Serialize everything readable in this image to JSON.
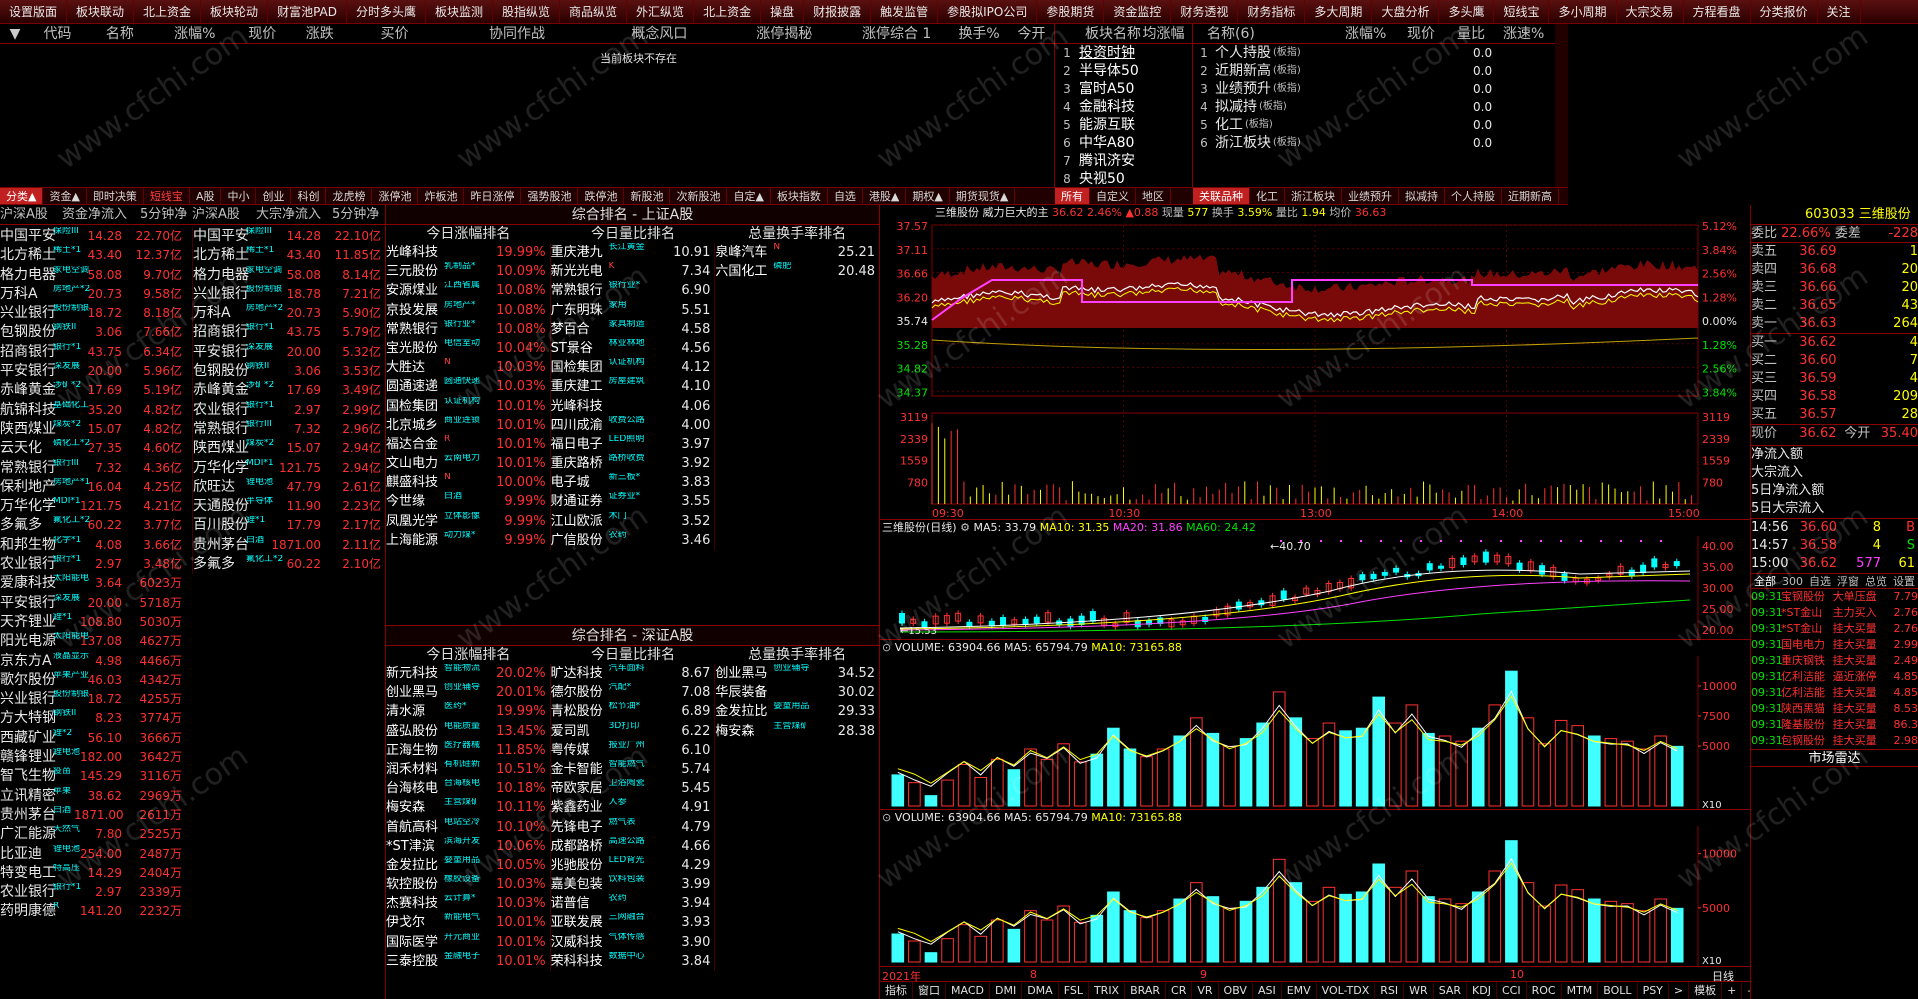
{
  "topbar": [
    "设置版面",
    "板块联动",
    "北上资金",
    "板块轮动",
    "财富池PAD",
    "分时多头鹰",
    "板块监测",
    "股指纵览",
    "商品纵览",
    "外汇纵览",
    "北上资金",
    "操盘",
    "财报披露",
    "触发监管",
    "参股拟IPO公司",
    "参股期货",
    "资金监控",
    "财务透视",
    "财务指标",
    "多大周期",
    "大盘分析",
    "多头鹰",
    "短线宝",
    "多小周期",
    "大宗交易",
    "方程看盘",
    "分类报价",
    "关注"
  ],
  "list_header": {
    "code": "代码",
    "name": "名称",
    "chg": "涨幅%",
    "price": "现价",
    "diff": "涨跌",
    "buy": "买价",
    "c1": "协同作战",
    "c2": "概念风口",
    "c3": "涨停揭秘",
    "c4": "涨停综合 1",
    "c5": "换手%",
    "c6": "今开"
  },
  "empty_text": "当前板块不存在",
  "sector_panel": {
    "h1": "板块名称",
    "h2": "均涨幅",
    "items": [
      "投资时钟",
      "半导体50",
      "富时A50",
      "金融科技",
      "能源互联",
      "中华A80",
      "腾讯济安",
      "央视50"
    ]
  },
  "related_panel": {
    "h_name": "名称(6)",
    "h_chg": "涨幅%",
    "h_price": "现价",
    "h_vol": "量比",
    "h_speed": "涨速%",
    "tag": "(板指)",
    "items": [
      {
        "name": "个人持股",
        "vol": "0.0"
      },
      {
        "name": "近期新高",
        "vol": "0.0"
      },
      {
        "name": "业绩预升",
        "vol": "0.0"
      },
      {
        "name": "拟减持",
        "vol": "0.0"
      },
      {
        "name": "化工",
        "vol": "0.0"
      },
      {
        "name": "浙江板块",
        "vol": "0.0"
      }
    ]
  },
  "tabs_left": [
    "分类▲",
    "资金▲",
    "即时决策",
    "短线宝",
    "A股",
    "中小",
    "创业",
    "科创",
    "龙虎榜",
    "涨停池",
    "炸板池",
    "昨日涨停",
    "强势股池",
    "跌停池",
    "新股池",
    "次新股池",
    "自定▲",
    "板块指数",
    "自选",
    "港股▲",
    "期权▲",
    "期货现货▲"
  ],
  "tabs_right": [
    "所有",
    "自定义",
    "地区"
  ],
  "tabs_rel": [
    "关联品种",
    "化工",
    "浙江板块",
    "业绩预升",
    "拟减持",
    "个人持股",
    "近期新高"
  ],
  "capital": {
    "h1": "沪深A股",
    "h2": "资金净流入",
    "h3": "5分钟净",
    "h4": "沪深A股",
    "h5": "大宗净流入",
    "h6": "5分钟净",
    "left": [
      [
        "中国平安",
        "保险III",
        "14.28",
        "22.70亿"
      ],
      [
        "北方稀土",
        "稀土*1",
        "43.40",
        "12.37亿"
      ],
      [
        "格力电器",
        "家电空调",
        "58.08",
        "9.70亿"
      ],
      [
        "万科A",
        "房地产*2",
        "20.73",
        "9.58亿"
      ],
      [
        "兴业银行",
        "股份制银",
        "18.72",
        "8.18亿"
      ],
      [
        "包钢股份",
        "钢铁II",
        "3.06",
        "7.66亿"
      ],
      [
        "招商银行",
        "银行*1",
        "43.75",
        "6.34亿"
      ],
      [
        "平安银行",
        "深发展",
        "20.00",
        "5.96亿"
      ],
      [
        "赤峰黄金",
        "涉矿*2",
        "17.69",
        "5.19亿"
      ],
      [
        "航锦科技",
        "基础化工",
        "35.20",
        "4.82亿"
      ],
      [
        "陕西煤业",
        "煤炭*2",
        "15.07",
        "4.82亿"
      ],
      [
        "云天化",
        "磷化工*2",
        "27.35",
        "4.60亿"
      ],
      [
        "常熟银行",
        "银行III",
        "7.32",
        "4.36亿"
      ],
      [
        "保利地产",
        "房地产*1",
        "16.04",
        "4.25亿"
      ],
      [
        "万华化学",
        "MDI*1",
        "121.75",
        "4.21亿"
      ],
      [
        "多氟多",
        "氟化工*2",
        "60.22",
        "3.77亿"
      ],
      [
        "和邦生物",
        "化学*1",
        "4.08",
        "3.66亿"
      ],
      [
        "农业银行",
        "银行*1",
        "2.97",
        "3.48亿"
      ],
      [
        "爱康科技",
        "太阳能电",
        "3.64",
        "6023万"
      ],
      [
        "平安银行",
        "深发展",
        "20.00",
        "5718万"
      ],
      [
        "天齐锂业",
        "锂*1",
        "108.80",
        "5030万"
      ],
      [
        "阳光电源",
        "太阳能电",
        "137.08",
        "4627万"
      ],
      [
        "京东方A",
        "液晶显示",
        "4.98",
        "4466万"
      ],
      [
        "歌尔股份",
        "苹果产业",
        "46.03",
        "4342万"
      ],
      [
        "兴业银行",
        "股份制银",
        "18.72",
        "4255万"
      ],
      [
        "方大特钢",
        "钢铁II",
        "8.23",
        "3774万"
      ],
      [
        "西藏矿业",
        "锂*2",
        "56.10",
        "3666万"
      ],
      [
        "赣锋锂业",
        "锂电池",
        "182.00",
        "3642万"
      ],
      [
        "智飞生物",
        "疫苗",
        "145.29",
        "3116万"
      ],
      [
        "立讯精密",
        "苹果",
        "38.62",
        "2969万"
      ],
      [
        "贵州茅台",
        "白酒",
        "1871.00",
        "2611万"
      ],
      [
        "广汇能源",
        "天然气",
        "7.80",
        "2525万"
      ],
      [
        "比亚迪",
        "锂电池",
        "254.00",
        "2487万"
      ],
      [
        "特变电工",
        "特高压",
        "14.29",
        "2404万"
      ],
      [
        "农业银行",
        "银行*1",
        "2.97",
        "2339万"
      ],
      [
        "药明康德",
        "R",
        "141.20",
        "2232万"
      ]
    ],
    "right": [
      [
        "中国平安",
        "保险III",
        "14.28",
        "22.10亿"
      ],
      [
        "北方稀土",
        "稀土*1",
        "43.40",
        "11.85亿"
      ],
      [
        "格力电器",
        "家电空调",
        "58.08",
        "8.14亿"
      ],
      [
        "兴业银行",
        "股份制银",
        "18.78",
        "7.21亿"
      ],
      [
        "万科A",
        "房地产*2",
        "20.73",
        "5.90亿"
      ],
      [
        "招商银行",
        "银行*1",
        "43.75",
        "5.79亿"
      ],
      [
        "平安银行",
        "深发展",
        "20.00",
        "5.32亿"
      ],
      [
        "包钢股份",
        "钢铁II",
        "3.06",
        "3.53亿"
      ],
      [
        "赤峰黄金",
        "涉矿*2",
        "17.69",
        "3.49亿"
      ],
      [
        "农业银行",
        "银行*1",
        "2.97",
        "2.99亿"
      ],
      [
        "常熟银行",
        "银行III",
        "7.32",
        "2.96亿"
      ],
      [
        "陕西煤业",
        "煤炭*2",
        "15.07",
        "2.94亿"
      ],
      [
        "万华化学",
        "MDI*1",
        "121.75",
        "2.94亿"
      ],
      [
        "欣旺达",
        "锂电池",
        "47.79",
        "2.61亿"
      ],
      [
        "天通股份",
        "半导体",
        "11.90",
        "2.23亿"
      ],
      [
        "百川股份",
        "锂*1",
        "17.79",
        "2.17亿"
      ],
      [
        "贵州茅台",
        "白酒",
        "1871.00",
        "2.11亿"
      ],
      [
        "多氟多",
        "氟化工*2",
        "60.22",
        "2.10亿"
      ]
    ]
  },
  "ranks": [
    {
      "title": "综合排名 - 上证A股",
      "c1": "今日涨幅排名",
      "c2": "今日量比排名",
      "c3": "总量换手率排名",
      "a": [
        [
          "光峰科技",
          "",
          "19.99%"
        ],
        [
          "三元股份",
          "乳制品*",
          "10.09%"
        ],
        [
          "安源煤业",
          "江西省属",
          "10.08%"
        ],
        [
          "京投发展",
          "房地产*",
          "10.08%"
        ],
        [
          "常熟银行",
          "银行业*",
          "10.08%"
        ],
        [
          "宝光股份",
          "电信室动",
          "10.04%"
        ],
        [
          "大胜达",
          "N",
          "10.03%"
        ],
        [
          "圆通速递",
          "圆通快递",
          "10.03%"
        ],
        [
          "国检集团",
          "认证机构",
          "10.01%"
        ],
        [
          "北京城乡",
          "商业连锁",
          "10.01%"
        ],
        [
          "福达合金",
          "R",
          "10.01%"
        ],
        [
          "文山电力",
          "云南电力",
          "10.01%"
        ],
        [
          "麒盛科技",
          "N",
          "10.00%"
        ],
        [
          "今世缘",
          "白酒",
          "9.99%"
        ],
        [
          "凤凰光学",
          "立体影像",
          "9.99%"
        ],
        [
          "上海能源",
          "动力煤*",
          "9.99%"
        ]
      ],
      "b": [
        [
          "重庆港九",
          "长江黄金",
          "10.91"
        ],
        [
          "新光光电",
          "K",
          "7.34"
        ],
        [
          "常熟银行",
          "银行业*",
          "6.90"
        ],
        [
          "广东明珠",
          "家用",
          "5.51"
        ],
        [
          "梦百合",
          "家具制造",
          "4.58"
        ],
        [
          "ST景谷",
          "林业林地",
          "4.56"
        ],
        [
          "国检集团",
          "认证机构",
          "4.12"
        ],
        [
          "重庆建工",
          "房屋建筑",
          "4.10"
        ],
        [
          "光峰科技",
          "",
          "4.06"
        ],
        [
          "四川成渝",
          "收费公路",
          "4.00"
        ],
        [
          "福日电子",
          "LED照明",
          "3.97"
        ],
        [
          "重庆路桥",
          "路桥收费",
          "3.92"
        ],
        [
          "电子城",
          "新三板*",
          "3.83"
        ],
        [
          "财通证券",
          "证券业*",
          "3.55"
        ],
        [
          "江山欧派",
          "木门",
          "3.52"
        ],
        [
          "广信股份",
          "农药",
          "3.46"
        ]
      ],
      "c": [
        [
          "泉峰汽车",
          "N",
          "25.21"
        ],
        [
          "六国化工",
          "磷肥",
          "20.48"
        ]
      ]
    },
    {
      "title": "综合排名 - 深证A股",
      "c1": "今日涨幅排名",
      "c2": "今日量比排名",
      "c3": "总量换手率排名",
      "a": [
        [
          "新元科技",
          "智能物流",
          "20.02%"
        ],
        [
          "创业黑马",
          "创业辅导",
          "20.01%"
        ],
        [
          "清水源",
          "医药*",
          "19.99%"
        ],
        [
          "盛弘股份",
          "电能质量",
          "13.45%"
        ],
        [
          "正海生物",
          "医疗器械",
          "11.85%"
        ],
        [
          "润禾材料",
          "有机硅新",
          "10.51%"
        ],
        [
          "台海核电",
          "台海核电",
          "10.18%"
        ],
        [
          "梅安森",
          "主营煤矿",
          "10.11%"
        ],
        [
          "首航高科",
          "电站空冷",
          "10.10%"
        ],
        [
          "*ST津滨",
          "滨海开发",
          "10.06%"
        ],
        [
          "金发拉比",
          "婴童用品",
          "10.05%"
        ],
        [
          "软控股份",
          "橡胶设备",
          "10.03%"
        ],
        [
          "杰赛科技",
          "云计算*",
          "10.03%"
        ],
        [
          "伊戈尔",
          "新能电气",
          "10.01%"
        ],
        [
          "国际医学",
          "开元商业",
          "10.01%"
        ],
        [
          "三泰控股",
          "金融电子",
          "10.01%"
        ]
      ],
      "b": [
        [
          "旷达科技",
          "汽车面料",
          "8.67"
        ],
        [
          "德尔股份",
          "汽配*",
          "7.08"
        ],
        [
          "青松股份",
          "松节油*",
          "6.89"
        ],
        [
          "爱司凯",
          "3D打印",
          "6.22"
        ],
        [
          "粤传媒",
          "报业广州",
          "6.10"
        ],
        [
          "金卡智能",
          "智能燃气",
          "5.74"
        ],
        [
          "帝欧家居",
          "卫浴陶瓷",
          "5.45"
        ],
        [
          "紫鑫药业",
          "人参",
          "4.91"
        ],
        [
          "先锋电子",
          "燃气表",
          "4.79"
        ],
        [
          "成都路桥",
          "高速公路",
          "4.66"
        ],
        [
          "兆驰股份",
          "LED背光",
          "4.29"
        ],
        [
          "嘉美包装",
          "饮料包装",
          "3.99"
        ],
        [
          "诺普信",
          "农药",
          "3.94"
        ],
        [
          "亚联发展",
          "三网融合",
          "3.93"
        ],
        [
          "汉威科技",
          "气体传感",
          "3.90"
        ],
        [
          "荣科科技",
          "数据中心",
          "3.84"
        ]
      ],
      "c": [
        [
          "创业黑马",
          "创业辅导",
          "34.52"
        ],
        [
          "华辰装备",
          "",
          "30.02"
        ],
        [
          "金发拉比",
          "婴童用品",
          "29.33"
        ],
        [
          "梅安森",
          "主营煤矿",
          "28.38"
        ]
      ]
    }
  ],
  "intraday": {
    "code": "三维股份",
    "title": "威力巨大的主",
    "v1": "36.62",
    "v2": "2.46%",
    "v3": "▲0.88",
    "vol_lbl": "现量",
    "vol": "577",
    "turn_lbl": "换手",
    "turn": "3.59%",
    "ratio_lbl": "量比",
    "ratio": "1.94",
    "avg_lbl": "均价",
    "avg": "36.63",
    "yleft": [
      "37.57",
      "37.11",
      "36.66",
      "36.20",
      "35.74",
      "35.28",
      "34.82",
      "34.37"
    ],
    "yright": [
      "5.12%",
      "3.84%",
      "2.56%",
      "1.28%",
      "0.00%",
      "1.28%",
      "2.56%",
      "3.84%"
    ],
    "vleft": [
      "3119",
      "2339",
      "1559",
      "780"
    ],
    "times": [
      "09:30",
      "10:30",
      "13:00",
      "14:00",
      "15:00"
    ]
  },
  "kline": {
    "title": "三维股份(日线)",
    "ma5": "MA5: 33.79",
    "ma10": "MA10: 31.35",
    "ma20": "MA20: 31.86",
    "ma60": "MA60: 24.42",
    "hi": "40.70",
    "lo": "15.53",
    "y": [
      "40.00",
      "35.00",
      "30.00",
      "25.00",
      "20.00"
    ]
  },
  "vol1": {
    "t": "VOLUME: 63904.66",
    "ma5": "MA5: 65794.79",
    "ma10": "MA10: 73165.88",
    "y": [
      "10000",
      "7500",
      "5000"
    ],
    "x10": "X10"
  },
  "vol2": {
    "t": "VOLUME: 63904.66",
    "ma5": "MA5: 65794.79",
    "ma10": "MA10: 73165.88",
    "y": [
      "10000",
      "5000"
    ],
    "x10": "X10"
  },
  "bottom_dates": {
    "y": "2021年",
    "m1": "8",
    "m2": "9",
    "m3": "10",
    "rl": "日线"
  },
  "ind_tabs": [
    "指标",
    "窗口",
    "MACD",
    "DMI",
    "DMA",
    "FSL",
    "TRIX",
    "BRAR",
    "CR",
    "VR",
    "OBV",
    "ASI",
    "EMV",
    "VOL-TDX",
    "RSI",
    "WR",
    "SAR",
    "KDJ",
    "CCI",
    "ROC",
    "MTM",
    "BOLL",
    "PSY",
    ">",
    "模板",
    "+",
    "-",
    "Z"
  ],
  "quote": {
    "code": "603033",
    "name": "三维股份",
    "wb_lbl": "委比",
    "wb": "22.66%",
    "wc_lbl": "委差",
    "wc": "-228",
    "sells": [
      [
        "卖五",
        "36.69",
        "1"
      ],
      [
        "卖四",
        "36.68",
        "20"
      ],
      [
        "卖三",
        "36.66",
        "20"
      ],
      [
        "卖二",
        "36.65",
        "43"
      ],
      [
        "卖一",
        "36.63",
        "264"
      ]
    ],
    "buys": [
      [
        "买一",
        "36.62",
        "4"
      ],
      [
        "买二",
        "36.60",
        "7"
      ],
      [
        "买三",
        "36.59",
        "4"
      ],
      [
        "买四",
        "36.58",
        "209"
      ],
      [
        "买五",
        "36.57",
        "28"
      ]
    ],
    "now_lbl": "现价",
    "now": "36.62",
    "open_lbl": "今开",
    "open": "35.40",
    "flow": [
      "净流入额",
      "大宗流入",
      "5日净流入额",
      "5日大宗流入"
    ],
    "ticks": [
      [
        "14:56",
        "36.60",
        "8",
        "B"
      ],
      [
        "14:57",
        "36.58",
        "4",
        "S"
      ],
      [
        "15:00",
        "36.62",
        "577",
        "61"
      ]
    ],
    "subtabs": [
      "全部",
      "300",
      "自选",
      "浮窗",
      "总览",
      "设置"
    ],
    "radar": [
      [
        "09:31",
        "宝钢股份",
        "大单压盘",
        "7.79"
      ],
      [
        "09:31",
        "*ST金山",
        "主力买入",
        "2.76"
      ],
      [
        "09:31",
        "*ST金山",
        "挂大买量",
        "2.76"
      ],
      [
        "09:31",
        "国电电力",
        "挂大买量",
        "2.99"
      ],
      [
        "09:31",
        "重庆钢铁",
        "挂大买量",
        "2.49"
      ],
      [
        "09:31",
        "亿利洁能",
        "逼近涨停",
        "4.85"
      ],
      [
        "09:31",
        "亿利洁能",
        "挂大买量",
        "4.85"
      ],
      [
        "09:31",
        "陕西黑猫",
        "挂大买量",
        "8.53"
      ],
      [
        "09:31",
        "隆基股份",
        "挂大买量",
        "86.3"
      ],
      [
        "09:31",
        "包钢股份",
        "挂大买量",
        "2.98"
      ]
    ],
    "radar_title": "市场雷达"
  },
  "watermark": "www.cfchi.com",
  "chart_data": {
    "type": "bar",
    "title": "VOLUME",
    "series": [
      {
        "name": "VOLUME",
        "values": [
          600,
          450,
          200,
          500,
          800,
          550,
          900,
          700,
          1100,
          900,
          1200,
          850,
          1000,
          1500,
          1100,
          950,
          1100,
          1350,
          1700,
          1400,
          1150,
          1300,
          1600,
          2200,
          1700,
          1300,
          1600,
          1450,
          1500,
          2100,
          1600,
          1950,
          1400,
          1350,
          1250,
          1500,
          1950,
          2600,
          1700,
          1200,
          1650,
          1550,
          1350,
          1300,
          1250,
          1100,
          1350,
          1150
        ]
      }
    ]
  }
}
